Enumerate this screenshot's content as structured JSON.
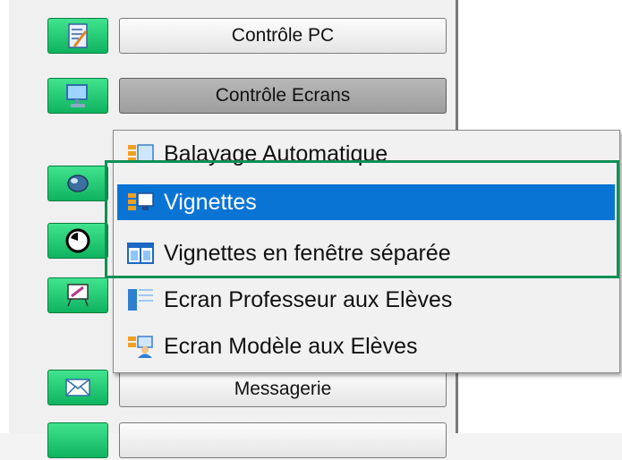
{
  "buttons": {
    "controle_pc": "Contrôle PC",
    "controle_ecrans": "Contrôle Ecrans",
    "messagerie": "Messagerie"
  },
  "menu": {
    "items": [
      {
        "label": "Balayage Automatique",
        "icon": "scan-icon"
      },
      {
        "label": "Vignettes",
        "icon": "thumbnails-icon"
      },
      {
        "label": "Vignettes en fenêtre séparée",
        "icon": "split-window-icon"
      },
      {
        "label": "Ecran Professeur aux Elèves",
        "icon": "teacher-screen-icon"
      },
      {
        "label": "Ecran Modèle aux Elèves",
        "icon": "model-screen-icon"
      }
    ],
    "selected": "Vignettes"
  },
  "colors": {
    "accent_green": "#16b866",
    "highlight_blue": "#0a74d4",
    "focus_border": "#0e8f54"
  }
}
